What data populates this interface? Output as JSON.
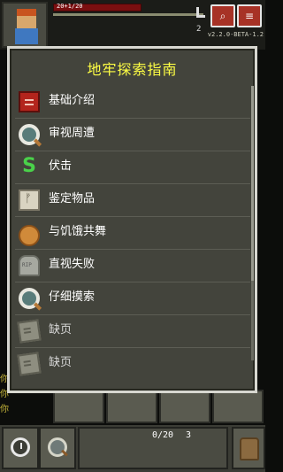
{
  "hud": {
    "hp_text": "20+1/20",
    "depth": "2",
    "version": "v2.2.0-BETA-1.2"
  },
  "log_lines": [
    "你",
    "你",
    "你"
  ],
  "journal": {
    "title": "地牢探索指南",
    "items": [
      {
        "label": "基础介绍",
        "icon": "red-book-icon",
        "available": true
      },
      {
        "label": "审视周遭",
        "icon": "magnifying-glass-icon",
        "available": true
      },
      {
        "label": "伏击",
        "icon": "snake-icon",
        "available": true
      },
      {
        "label": "鉴定物品",
        "icon": "scroll-icon",
        "available": true
      },
      {
        "label": "与饥饿共舞",
        "icon": "bread-icon",
        "available": true
      },
      {
        "label": "直视失败",
        "icon": "tombstone-icon",
        "available": true
      },
      {
        "label": "仔细摸索",
        "icon": "magnifying-glass-icon",
        "available": true
      },
      {
        "label": "缺页",
        "icon": "torn-page-icon",
        "available": false
      },
      {
        "label": "缺页",
        "icon": "torn-page-icon",
        "available": false
      }
    ]
  },
  "toolbar": {
    "pack_count": "0/20",
    "stack_count": "3"
  },
  "colors": {
    "title": "#ffff44",
    "window_bg": "#43443c",
    "window_border": "#d7d7d0",
    "hp_bar": "#7a0f10",
    "danger_button": "#a73226"
  }
}
